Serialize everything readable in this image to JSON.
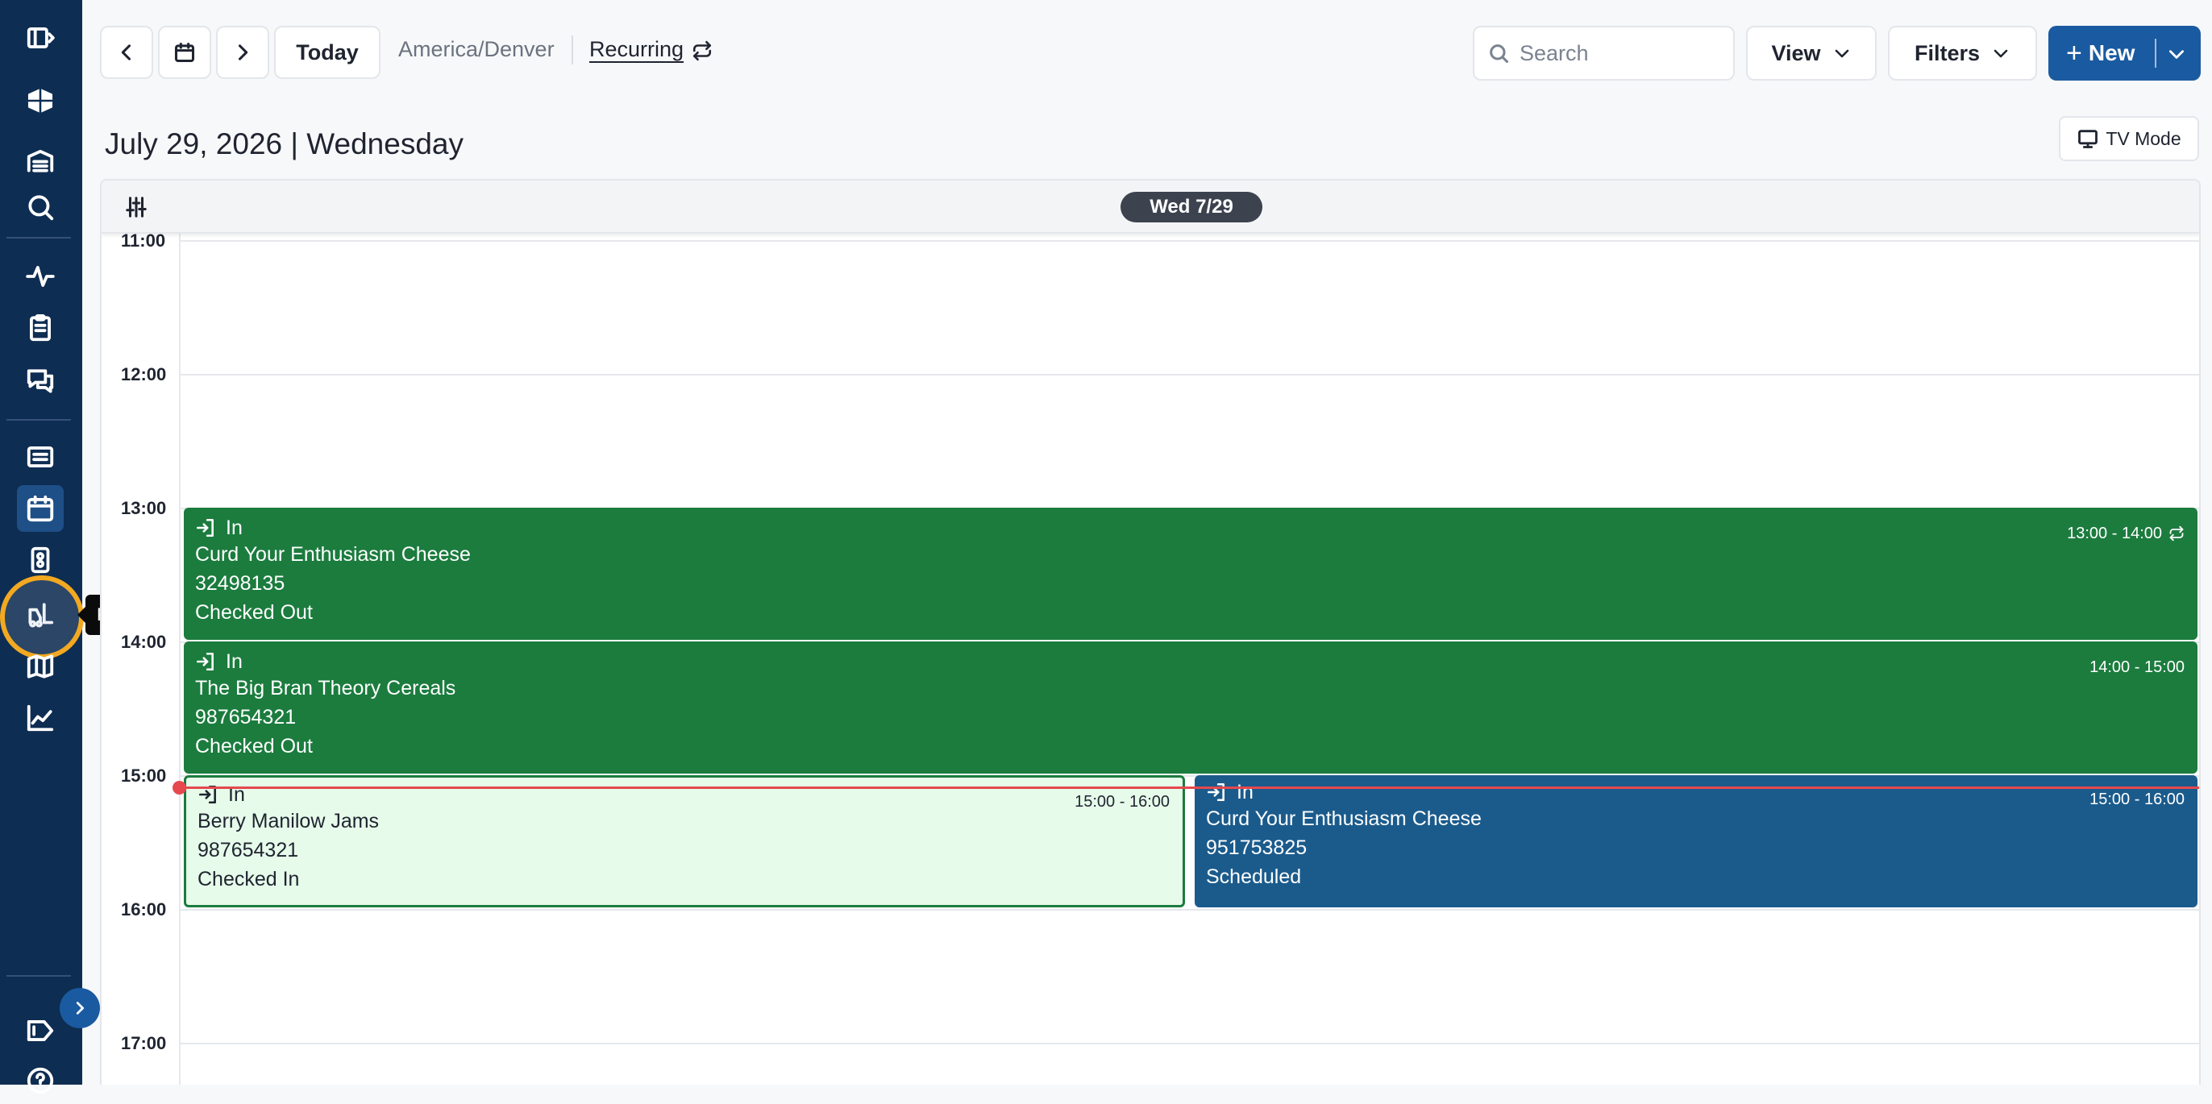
{
  "sidebar": {
    "tooltip": "Forklift",
    "items": [
      {
        "icon": "sidebar-toggle-icon"
      },
      {
        "icon": "logo-icon"
      },
      {
        "icon": "warehouse-icon"
      },
      {
        "icon": "search-icon"
      },
      {
        "icon": "activity-icon"
      },
      {
        "icon": "clipboard-icon"
      },
      {
        "icon": "chat-icon"
      },
      {
        "icon": "list-icon"
      },
      {
        "icon": "calendar-icon"
      },
      {
        "icon": "dock-icon"
      },
      {
        "icon": "forklift-icon"
      },
      {
        "icon": "map-icon"
      },
      {
        "icon": "chart-icon"
      },
      {
        "icon": "tag-icon"
      },
      {
        "icon": "help-icon"
      }
    ]
  },
  "toolbar": {
    "today_label": "Today",
    "timezone": "America/Denver",
    "recurring_label": "Recurring",
    "search_placeholder": "Search",
    "view_label": "View",
    "filters_label": "Filters",
    "new_label": "New",
    "tv_mode_label": "TV Mode"
  },
  "page": {
    "date_title": "July 29, 2026 | Wednesday"
  },
  "calendar": {
    "day_label": "Wed 7/29",
    "hours": [
      "11:00",
      "12:00",
      "13:00",
      "14:00",
      "15:00",
      "16:00",
      "17:00"
    ],
    "events": [
      {
        "direction": "In",
        "carrier": "Curd Your Enthusiasm Cheese",
        "ref": "32498135",
        "status": "Checked Out",
        "time": "13:00 - 14:00",
        "recurring": true,
        "color": "#1b7c3e"
      },
      {
        "direction": "In",
        "carrier": "The Big Bran Theory Cereals",
        "ref": "987654321",
        "status": "Checked Out",
        "time": "14:00 - 15:00",
        "recurring": false,
        "color": "#1b7c3e"
      },
      {
        "direction": "In",
        "carrier": "Berry Manilow Jams",
        "ref": "987654321",
        "status": "Checked In",
        "time": "15:00 - 16:00",
        "recurring": false,
        "color": "#e6fbea"
      },
      {
        "direction": "In",
        "carrier": "Curd Your Enthusiasm Cheese",
        "ref": "951753825",
        "status": "Scheduled",
        "time": "15:00 - 16:00",
        "recurring": false,
        "color": "#1b5b8c"
      }
    ]
  }
}
